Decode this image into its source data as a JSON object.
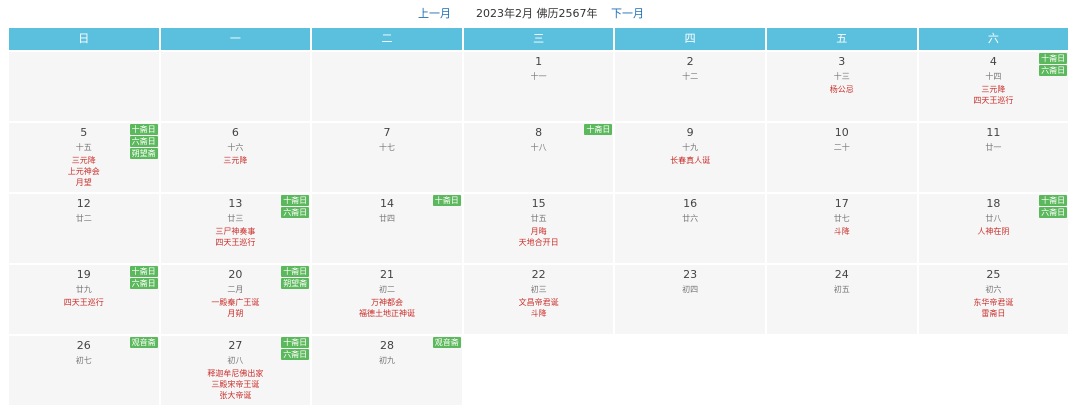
{
  "nav": {
    "prev": "上一月",
    "title": "2023年2月 佛历2567年",
    "next": "下一月"
  },
  "weekdays": [
    "日",
    "一",
    "二",
    "三",
    "四",
    "五",
    "六"
  ],
  "weeks": [
    [
      null,
      null,
      null,
      {
        "day": "1",
        "lunar": "十一",
        "events": [],
        "badges": []
      },
      {
        "day": "2",
        "lunar": "十二",
        "events": [],
        "badges": []
      },
      {
        "day": "3",
        "lunar": "十三",
        "events": [
          "杨公忌"
        ],
        "badges": []
      },
      {
        "day": "4",
        "lunar": "十四",
        "events": [
          "三元降",
          "四天王巡行"
        ],
        "badges": [
          "十斋日",
          "六斋日"
        ]
      }
    ],
    [
      {
        "day": "5",
        "lunar": "十五",
        "events": [
          "三元降",
          "上元神会",
          "月望"
        ],
        "badges": [
          "十斋日",
          "六斋日",
          "朔望斋"
        ]
      },
      {
        "day": "6",
        "lunar": "十六",
        "events": [
          "三元降"
        ],
        "badges": []
      },
      {
        "day": "7",
        "lunar": "十七",
        "events": [],
        "badges": []
      },
      {
        "day": "8",
        "lunar": "十八",
        "events": [],
        "badges": [
          "十斋日"
        ]
      },
      {
        "day": "9",
        "lunar": "十九",
        "events": [
          "长春真人诞"
        ],
        "badges": []
      },
      {
        "day": "10",
        "lunar": "二十",
        "events": [],
        "badges": []
      },
      {
        "day": "11",
        "lunar": "廿一",
        "events": [],
        "badges": []
      }
    ],
    [
      {
        "day": "12",
        "lunar": "廿二",
        "events": [],
        "badges": []
      },
      {
        "day": "13",
        "lunar": "廿三",
        "events": [
          "三尸神奏事",
          "四天王巡行"
        ],
        "badges": [
          "十斋日",
          "六斋日"
        ]
      },
      {
        "day": "14",
        "lunar": "廿四",
        "events": [],
        "badges": [
          "十斋日"
        ]
      },
      {
        "day": "15",
        "lunar": "廿五",
        "events": [
          "月晦",
          "天地合开日"
        ],
        "badges": []
      },
      {
        "day": "16",
        "lunar": "廿六",
        "events": [],
        "badges": []
      },
      {
        "day": "17",
        "lunar": "廿七",
        "events": [
          "斗降"
        ],
        "badges": []
      },
      {
        "day": "18",
        "lunar": "廿八",
        "events": [
          "人神在阴"
        ],
        "badges": [
          "十斋日",
          "六斋日"
        ]
      }
    ],
    [
      {
        "day": "19",
        "lunar": "廿九",
        "events": [
          "四天王巡行"
        ],
        "badges": [
          "十斋日",
          "六斋日"
        ]
      },
      {
        "day": "20",
        "lunar": "二月",
        "events": [
          "一殿秦广王诞",
          "月朔"
        ],
        "badges": [
          "十斋日",
          "朔望斋"
        ]
      },
      {
        "day": "21",
        "lunar": "初二",
        "events": [
          "万神都会",
          "福德土地正神诞"
        ],
        "badges": []
      },
      {
        "day": "22",
        "lunar": "初三",
        "events": [
          "文昌帝君诞",
          "斗降"
        ],
        "badges": []
      },
      {
        "day": "23",
        "lunar": "初四",
        "events": [],
        "badges": []
      },
      {
        "day": "24",
        "lunar": "初五",
        "events": [],
        "badges": []
      },
      {
        "day": "25",
        "lunar": "初六",
        "events": [
          "东华帝君诞",
          "雷斋日"
        ],
        "badges": []
      }
    ],
    [
      {
        "day": "26",
        "lunar": "初七",
        "events": [],
        "badges": [
          "观音斋"
        ]
      },
      {
        "day": "27",
        "lunar": "初八",
        "events": [
          "释迦牟尼佛出家",
          "三殿宋帝王诞",
          "张大帝诞"
        ],
        "badges": [
          "十斋日",
          "六斋日"
        ]
      },
      {
        "day": "28",
        "lunar": "初九",
        "events": [],
        "badges": [
          "观音斋"
        ]
      },
      "blank",
      "blank",
      "blank",
      "blank"
    ]
  ]
}
